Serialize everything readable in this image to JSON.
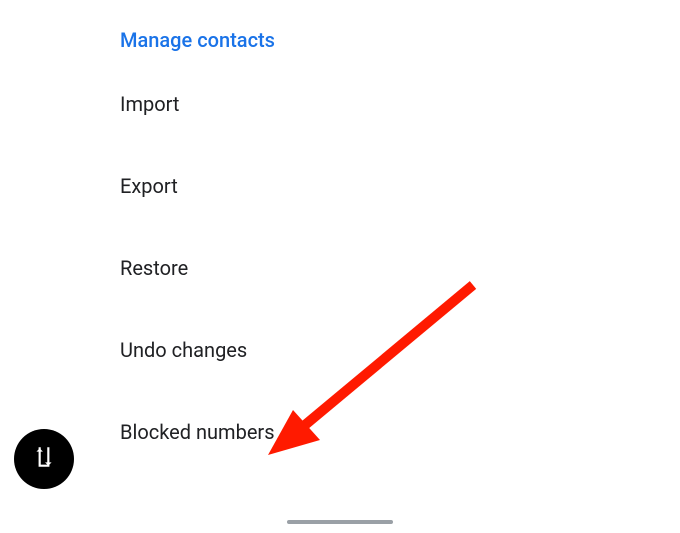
{
  "section": {
    "header": "Manage contacts",
    "items": [
      {
        "label": "Import"
      },
      {
        "label": "Export"
      },
      {
        "label": "Restore"
      },
      {
        "label": "Undo changes"
      },
      {
        "label": "Blocked numbers"
      }
    ]
  },
  "annotation": {
    "arrow_color": "#ff1a00"
  }
}
